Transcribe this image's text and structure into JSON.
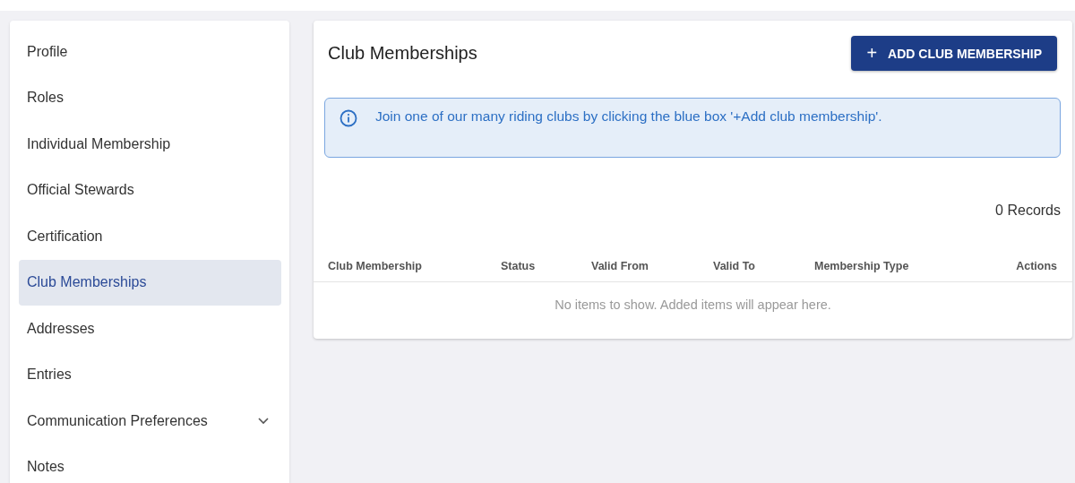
{
  "sidebar": {
    "items": [
      {
        "label": "Profile",
        "selected": false
      },
      {
        "label": "Roles",
        "selected": false
      },
      {
        "label": "Individual Membership",
        "selected": false
      },
      {
        "label": "Official Stewards",
        "selected": false
      },
      {
        "label": "Certification",
        "selected": false
      },
      {
        "label": "Club Memberships",
        "selected": true
      },
      {
        "label": "Addresses",
        "selected": false
      },
      {
        "label": "Entries",
        "selected": false
      },
      {
        "label": "Communication Preferences",
        "selected": false,
        "expandable": true
      },
      {
        "label": "Notes",
        "selected": false
      }
    ]
  },
  "main": {
    "title": "Club Memberships",
    "add_button": {
      "icon": "+",
      "label": "ADD CLUB MEMBERSHIP"
    },
    "info": "Join one of our many riding clubs by clicking the blue box '+Add club membership'.",
    "records": "0 Records",
    "table": {
      "columns": [
        "Club Membership",
        "Status",
        "Valid From",
        "Valid To",
        "Membership Type",
        "Actions"
      ],
      "empty": "No items to show. Added items will appear here."
    }
  }
}
